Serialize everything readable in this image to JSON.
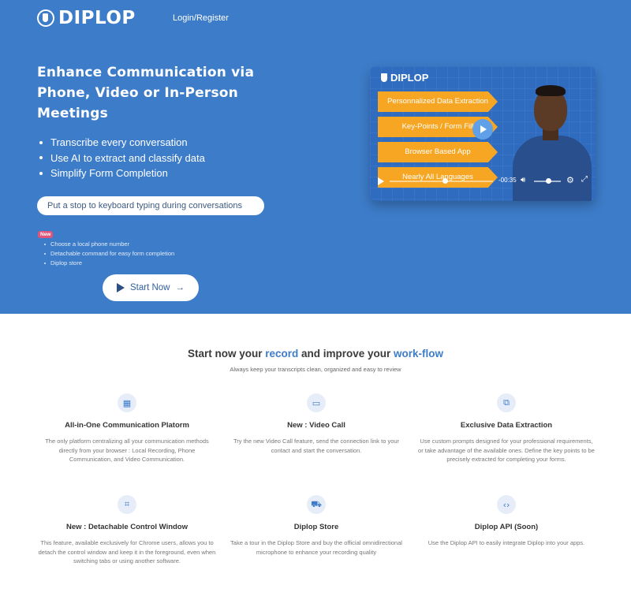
{
  "header": {
    "logo_text": "DIPLOP",
    "login_label": "Login/Register"
  },
  "hero": {
    "title": "Enhance Communication via Phone, Video or In-Person Meetings",
    "bullets": [
      "Transcribe every conversation",
      "Use AI to extract and classify data",
      "Simplify Form Completion"
    ],
    "pill_text": "Put a stop to keyboard typing during conversations",
    "new_badge": "New",
    "new_items": [
      "Choose a local phone number",
      "Detachable command for easy form completion",
      "Diplop store"
    ],
    "start_button_label": "Start Now",
    "start_button_arrow": "→"
  },
  "video": {
    "logo_text": "DIPLOP",
    "labels": [
      "Personnalized Data Extraction",
      "Key-Points / Form Fill",
      "Browser Based App",
      "Nearly All Languages"
    ],
    "time": "-00:35"
  },
  "features_section": {
    "title_parts": [
      "Start now your ",
      "record",
      " and improve your ",
      "work-flow"
    ],
    "subtitle": "Always keep your transcripts clean, organized and easy to review",
    "features": [
      {
        "icon": "grid-icon",
        "title": "All-in-One Communication Platorm",
        "desc": "The only platform centralizing all your communication methods directly from your browser : Local Recording, Phone Communication, and Video Communication."
      },
      {
        "icon": "monitor-icon",
        "title": "New : Video Call",
        "desc": "Try the new Video Call feature, send the connection link to your contact and start the conversation."
      },
      {
        "icon": "extract-icon",
        "title": "Exclusive Data Extraction",
        "desc": "Use custom prompts designed for your professional requirements, or take advantage of the available ones. Define the key points to be precisely extracted for completing your forms."
      },
      {
        "icon": "window-icon",
        "title": "New : Detachable Control Window",
        "desc": "This feature, available exclusively for Chrome users, allows you to detach the control window and keep it in the foreground, even when switching tabs or using another software."
      },
      {
        "icon": "cart-icon",
        "title": "Diplop Store",
        "desc": "Take a tour in the Diplop Store and buy the official omnidirectional microphone to enhance your recording quality"
      },
      {
        "icon": "code-icon",
        "title": "Diplop API (Soon)",
        "desc": "Use the Diplop API to easily integrate Diplop into your apps."
      }
    ]
  },
  "colors": {
    "hero_bg": "#3d7cc9",
    "accent": "#3d7cc9",
    "label_orange": "#f6a623",
    "badge_pink": "#e0557a"
  }
}
